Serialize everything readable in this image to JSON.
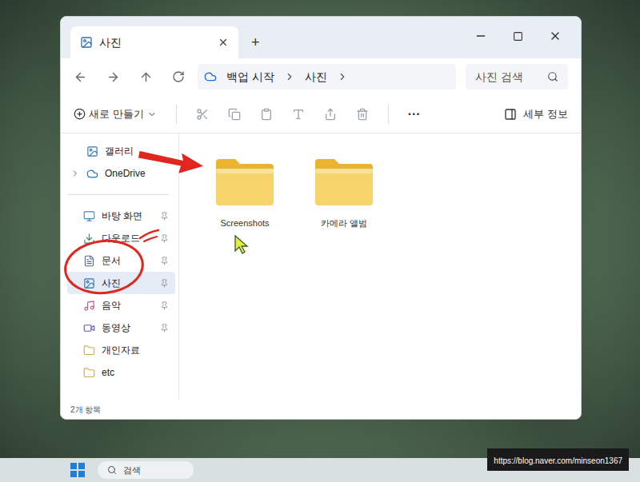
{
  "window": {
    "tab_title": "사진",
    "new_tab": "+"
  },
  "address": {
    "segments": [
      "백업 시작",
      "사진"
    ]
  },
  "search": {
    "placeholder": "사진 검색"
  },
  "toolbar": {
    "new": "새로 만들기",
    "more": "···",
    "details": "세부 정보"
  },
  "sidebar": {
    "top": [
      {
        "label": "갤러리",
        "kind": "gallery",
        "expandable": false
      },
      {
        "label": "OneDrive",
        "kind": "cloud",
        "expandable": true
      }
    ],
    "items": [
      {
        "label": "바탕 화면",
        "kind": "desktop",
        "pinned": true,
        "selected": false
      },
      {
        "label": "다운로드",
        "kind": "download",
        "pinned": true,
        "selected": false
      },
      {
        "label": "문서",
        "kind": "document",
        "pinned": true,
        "selected": false
      },
      {
        "label": "사진",
        "kind": "picture",
        "pinned": true,
        "selected": true
      },
      {
        "label": "음악",
        "kind": "music",
        "pinned": true,
        "selected": false
      },
      {
        "label": "동영상",
        "kind": "video",
        "pinned": true,
        "selected": false
      },
      {
        "label": "개인자료",
        "kind": "folder",
        "pinned": false,
        "selected": false
      },
      {
        "label": "etc",
        "kind": "folder",
        "pinned": false,
        "selected": false
      }
    ]
  },
  "folders": [
    {
      "name": "Screenshots",
      "selected": false
    },
    {
      "name": "카메라 앨범",
      "selected": false
    }
  ],
  "status_bar": "2개 항목",
  "taskbar": {
    "search": "검색"
  },
  "watermark": "https://blog.naver.com/minseon1367"
}
